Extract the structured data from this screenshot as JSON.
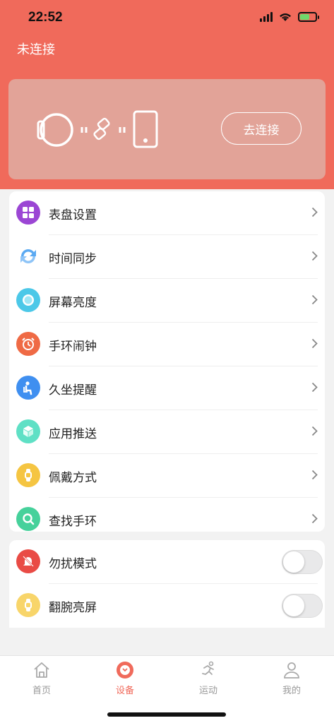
{
  "status_bar": {
    "time": "22:52"
  },
  "header": {
    "connection_status": "未连接"
  },
  "device_card": {
    "connect_label": "去连接"
  },
  "menu": {
    "items": [
      {
        "label": "表盘设置",
        "icon": "dial-icon",
        "color": "#9b46d4"
      },
      {
        "label": "时间同步",
        "icon": "sync-icon",
        "color": "#5aa9f2"
      },
      {
        "label": "屏幕亮度",
        "icon": "brightness-icon",
        "color": "#4cc8e8"
      },
      {
        "label": "手环闹钟",
        "icon": "alarm-icon",
        "color": "#ef6a45"
      },
      {
        "label": "久坐提醒",
        "icon": "sitting-icon",
        "color": "#3f8ff0"
      },
      {
        "label": "应用推送",
        "icon": "cube-icon",
        "color": "#5fe0c5"
      },
      {
        "label": "佩戴方式",
        "icon": "watch-icon",
        "color": "#f5c542"
      },
      {
        "label": "查找手环",
        "icon": "magnifier-icon",
        "color": "#46d19b"
      }
    ]
  },
  "toggles": {
    "items": [
      {
        "label": "勿扰模式",
        "icon": "dnd-bell-icon",
        "color": "#e94b45",
        "on": false
      },
      {
        "label": "翻腕亮屏",
        "icon": "wrist-icon",
        "color": "#f8d56a",
        "on": false
      }
    ]
  },
  "tabbar": {
    "tabs": [
      {
        "label": "首页",
        "icon": "home-icon",
        "active": false
      },
      {
        "label": "设备",
        "icon": "device-icon",
        "active": true
      },
      {
        "label": "运动",
        "icon": "run-icon",
        "active": false
      },
      {
        "label": "我的",
        "icon": "profile-icon",
        "active": false
      }
    ]
  },
  "colors": {
    "accent": "#f06a5b",
    "card_overlay": "#e2a398"
  }
}
